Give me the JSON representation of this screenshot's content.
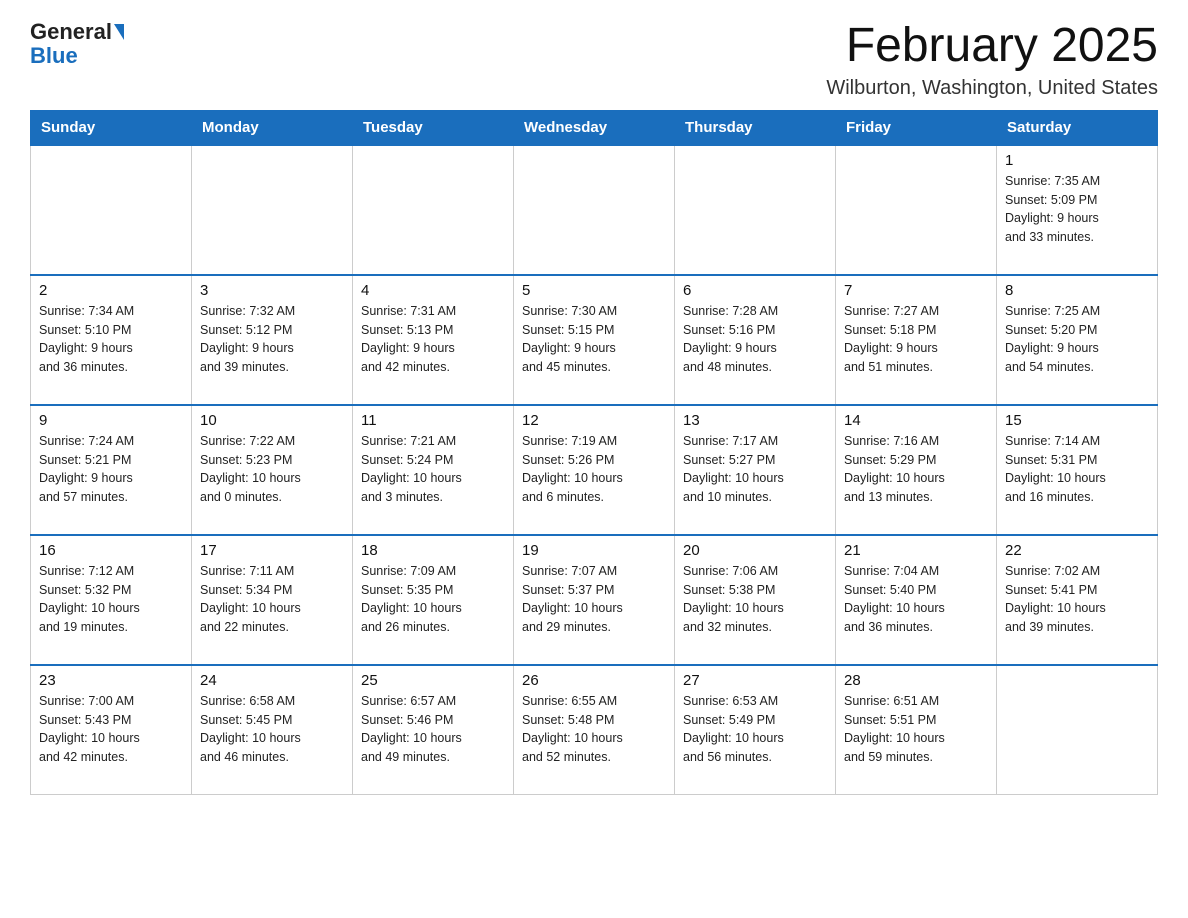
{
  "header": {
    "logo_general": "General",
    "logo_blue": "Blue",
    "calendar_title": "February 2025",
    "calendar_subtitle": "Wilburton, Washington, United States"
  },
  "weekdays": [
    "Sunday",
    "Monday",
    "Tuesday",
    "Wednesday",
    "Thursday",
    "Friday",
    "Saturday"
  ],
  "weeks": [
    [
      {
        "day": "",
        "info": ""
      },
      {
        "day": "",
        "info": ""
      },
      {
        "day": "",
        "info": ""
      },
      {
        "day": "",
        "info": ""
      },
      {
        "day": "",
        "info": ""
      },
      {
        "day": "",
        "info": ""
      },
      {
        "day": "1",
        "info": "Sunrise: 7:35 AM\nSunset: 5:09 PM\nDaylight: 9 hours\nand 33 minutes."
      }
    ],
    [
      {
        "day": "2",
        "info": "Sunrise: 7:34 AM\nSunset: 5:10 PM\nDaylight: 9 hours\nand 36 minutes."
      },
      {
        "day": "3",
        "info": "Sunrise: 7:32 AM\nSunset: 5:12 PM\nDaylight: 9 hours\nand 39 minutes."
      },
      {
        "day": "4",
        "info": "Sunrise: 7:31 AM\nSunset: 5:13 PM\nDaylight: 9 hours\nand 42 minutes."
      },
      {
        "day": "5",
        "info": "Sunrise: 7:30 AM\nSunset: 5:15 PM\nDaylight: 9 hours\nand 45 minutes."
      },
      {
        "day": "6",
        "info": "Sunrise: 7:28 AM\nSunset: 5:16 PM\nDaylight: 9 hours\nand 48 minutes."
      },
      {
        "day": "7",
        "info": "Sunrise: 7:27 AM\nSunset: 5:18 PM\nDaylight: 9 hours\nand 51 minutes."
      },
      {
        "day": "8",
        "info": "Sunrise: 7:25 AM\nSunset: 5:20 PM\nDaylight: 9 hours\nand 54 minutes."
      }
    ],
    [
      {
        "day": "9",
        "info": "Sunrise: 7:24 AM\nSunset: 5:21 PM\nDaylight: 9 hours\nand 57 minutes."
      },
      {
        "day": "10",
        "info": "Sunrise: 7:22 AM\nSunset: 5:23 PM\nDaylight: 10 hours\nand 0 minutes."
      },
      {
        "day": "11",
        "info": "Sunrise: 7:21 AM\nSunset: 5:24 PM\nDaylight: 10 hours\nand 3 minutes."
      },
      {
        "day": "12",
        "info": "Sunrise: 7:19 AM\nSunset: 5:26 PM\nDaylight: 10 hours\nand 6 minutes."
      },
      {
        "day": "13",
        "info": "Sunrise: 7:17 AM\nSunset: 5:27 PM\nDaylight: 10 hours\nand 10 minutes."
      },
      {
        "day": "14",
        "info": "Sunrise: 7:16 AM\nSunset: 5:29 PM\nDaylight: 10 hours\nand 13 minutes."
      },
      {
        "day": "15",
        "info": "Sunrise: 7:14 AM\nSunset: 5:31 PM\nDaylight: 10 hours\nand 16 minutes."
      }
    ],
    [
      {
        "day": "16",
        "info": "Sunrise: 7:12 AM\nSunset: 5:32 PM\nDaylight: 10 hours\nand 19 minutes."
      },
      {
        "day": "17",
        "info": "Sunrise: 7:11 AM\nSunset: 5:34 PM\nDaylight: 10 hours\nand 22 minutes."
      },
      {
        "day": "18",
        "info": "Sunrise: 7:09 AM\nSunset: 5:35 PM\nDaylight: 10 hours\nand 26 minutes."
      },
      {
        "day": "19",
        "info": "Sunrise: 7:07 AM\nSunset: 5:37 PM\nDaylight: 10 hours\nand 29 minutes."
      },
      {
        "day": "20",
        "info": "Sunrise: 7:06 AM\nSunset: 5:38 PM\nDaylight: 10 hours\nand 32 minutes."
      },
      {
        "day": "21",
        "info": "Sunrise: 7:04 AM\nSunset: 5:40 PM\nDaylight: 10 hours\nand 36 minutes."
      },
      {
        "day": "22",
        "info": "Sunrise: 7:02 AM\nSunset: 5:41 PM\nDaylight: 10 hours\nand 39 minutes."
      }
    ],
    [
      {
        "day": "23",
        "info": "Sunrise: 7:00 AM\nSunset: 5:43 PM\nDaylight: 10 hours\nand 42 minutes."
      },
      {
        "day": "24",
        "info": "Sunrise: 6:58 AM\nSunset: 5:45 PM\nDaylight: 10 hours\nand 46 minutes."
      },
      {
        "day": "25",
        "info": "Sunrise: 6:57 AM\nSunset: 5:46 PM\nDaylight: 10 hours\nand 49 minutes."
      },
      {
        "day": "26",
        "info": "Sunrise: 6:55 AM\nSunset: 5:48 PM\nDaylight: 10 hours\nand 52 minutes."
      },
      {
        "day": "27",
        "info": "Sunrise: 6:53 AM\nSunset: 5:49 PM\nDaylight: 10 hours\nand 56 minutes."
      },
      {
        "day": "28",
        "info": "Sunrise: 6:51 AM\nSunset: 5:51 PM\nDaylight: 10 hours\nand 59 minutes."
      },
      {
        "day": "",
        "info": ""
      }
    ]
  ]
}
